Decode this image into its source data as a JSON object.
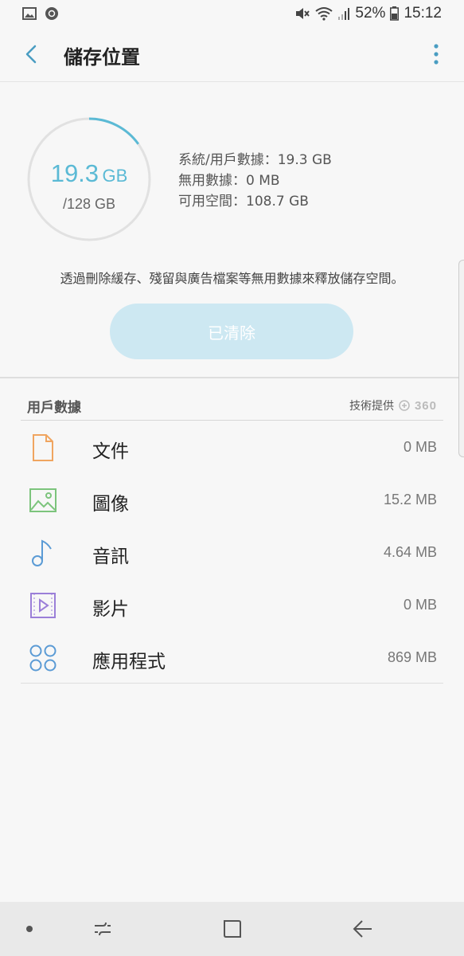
{
  "status_bar": {
    "battery_percent": "52%",
    "time": "15:12",
    "icons": [
      "gallery-icon",
      "settings-notification-icon",
      "mute-icon",
      "wifi-icon",
      "signal-icon",
      "battery-icon"
    ]
  },
  "header": {
    "title": "儲存位置",
    "back_icon": "back-arrow-icon",
    "more_icon": "more-vertical-icon"
  },
  "storage": {
    "used_value": "19.3",
    "used_unit": "GB",
    "total": "/128 GB",
    "used_fraction": 0.151,
    "accent_color": "#5bbad5",
    "stats": [
      "系統/用戶數據：19.3 GB",
      "無用數據：0 MB",
      "可用空間：108.7 GB"
    ]
  },
  "cleanup": {
    "description": "透過刪除緩存、殘留與廣告檔案等無用數據來釋放儲存空間。",
    "button_label": "已清除"
  },
  "user_data": {
    "section_title": "用戶數據",
    "provider_label": "技術提供",
    "provider_brand": "360",
    "items": [
      {
        "label": "文件",
        "size": "0 MB",
        "icon": "document-icon",
        "color": "#f0a560"
      },
      {
        "label": "圖像",
        "size": "15.2 MB",
        "icon": "image-icon",
        "color": "#7cc47c"
      },
      {
        "label": "音訊",
        "size": "4.64 MB",
        "icon": "music-note-icon",
        "color": "#5b9bd5"
      },
      {
        "label": "影片",
        "size": "0 MB",
        "icon": "video-icon",
        "color": "#9b7fd8"
      },
      {
        "label": "應用程式",
        "size": "869 MB",
        "icon": "apps-icon",
        "color": "#5b9bd5"
      }
    ]
  },
  "nav_bar": {
    "icons": [
      "nav-dot-icon",
      "recent-apps-icon",
      "home-icon",
      "back-icon"
    ]
  }
}
